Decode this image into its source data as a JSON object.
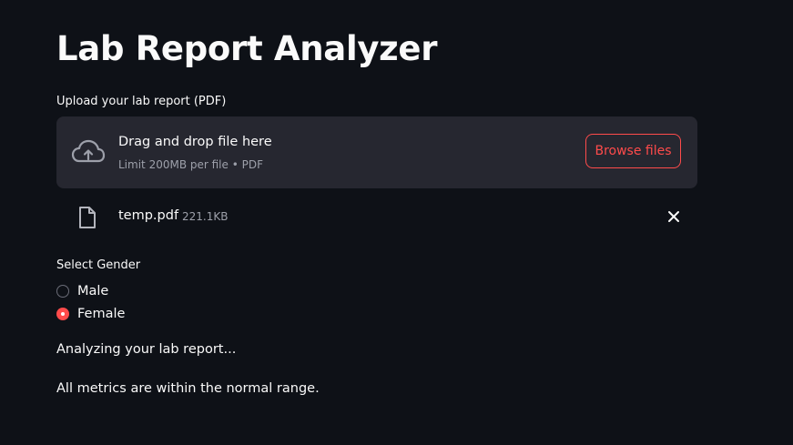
{
  "page": {
    "title": "Lab Report Analyzer"
  },
  "uploader": {
    "label": "Upload your lab report (PDF)",
    "drag_text": "Drag and drop file here",
    "limit_text": "Limit 200MB per file • PDF",
    "browse_label": "Browse files",
    "icon": "cloud-upload-icon"
  },
  "uploaded_file": {
    "name": "temp.pdf",
    "size": "221.1KB",
    "icon": "file-icon",
    "remove_icon": "close-icon"
  },
  "gender": {
    "label": "Select Gender",
    "options": [
      {
        "label": "Male",
        "selected": false
      },
      {
        "label": "Female",
        "selected": true
      }
    ]
  },
  "messages": {
    "analyzing": "Analyzing your lab report...",
    "result": "All metrics are within the normal range."
  },
  "colors": {
    "background": "#0e1117",
    "surface": "#262730",
    "accent": "#ff4b4b",
    "text": "#fafafa",
    "muted": "#9da0aa"
  }
}
